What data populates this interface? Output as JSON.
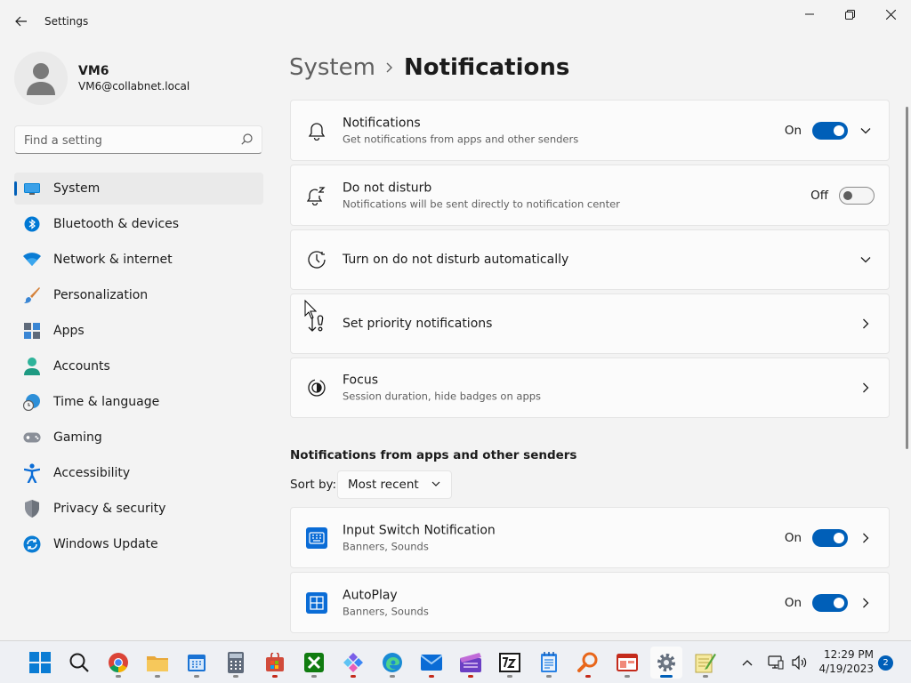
{
  "window": {
    "title": "Settings"
  },
  "profile": {
    "name": "VM6",
    "email": "VM6@collabnet.local"
  },
  "search": {
    "placeholder": "Find a setting"
  },
  "sidebar": {
    "items": [
      {
        "label": "System",
        "icon": "monitor-icon",
        "active": true
      },
      {
        "label": "Bluetooth & devices",
        "icon": "bluetooth-icon"
      },
      {
        "label": "Network & internet",
        "icon": "wifi-icon"
      },
      {
        "label": "Personalization",
        "icon": "paintbrush-icon"
      },
      {
        "label": "Apps",
        "icon": "apps-icon"
      },
      {
        "label": "Accounts",
        "icon": "person-icon"
      },
      {
        "label": "Time & language",
        "icon": "globe-clock-icon"
      },
      {
        "label": "Gaming",
        "icon": "gamepad-icon"
      },
      {
        "label": "Accessibility",
        "icon": "accessibility-icon"
      },
      {
        "label": "Privacy & security",
        "icon": "shield-icon"
      },
      {
        "label": "Windows Update",
        "icon": "update-icon"
      }
    ]
  },
  "breadcrumb": {
    "parent": "System",
    "current": "Notifications"
  },
  "settings": {
    "notifications": {
      "title": "Notifications",
      "subtitle": "Get notifications from apps and other senders",
      "state": "On"
    },
    "dnd": {
      "title": "Do not disturb",
      "subtitle": "Notifications will be sent directly to notification center",
      "state": "Off"
    },
    "dnd_auto": {
      "title": "Turn on do not disturb automatically"
    },
    "priority": {
      "title": "Set priority notifications"
    },
    "focus": {
      "title": "Focus",
      "subtitle": "Session duration, hide badges on apps"
    }
  },
  "apps_section": {
    "title": "Notifications from apps and other senders",
    "sort_label": "Sort by:",
    "sort_value": "Most recent",
    "apps": [
      {
        "name": "Input Switch Notification",
        "detail": "Banners, Sounds",
        "state": "On"
      },
      {
        "name": "AutoPlay",
        "detail": "Banners, Sounds",
        "state": "On"
      }
    ]
  },
  "taskbar": {
    "clock_time": "12:29 PM",
    "clock_date": "4/19/2023",
    "notification_count": "2"
  },
  "colors": {
    "accent": "#005fb8",
    "background": "#f3f3f3",
    "card": "#fbfbfb"
  }
}
